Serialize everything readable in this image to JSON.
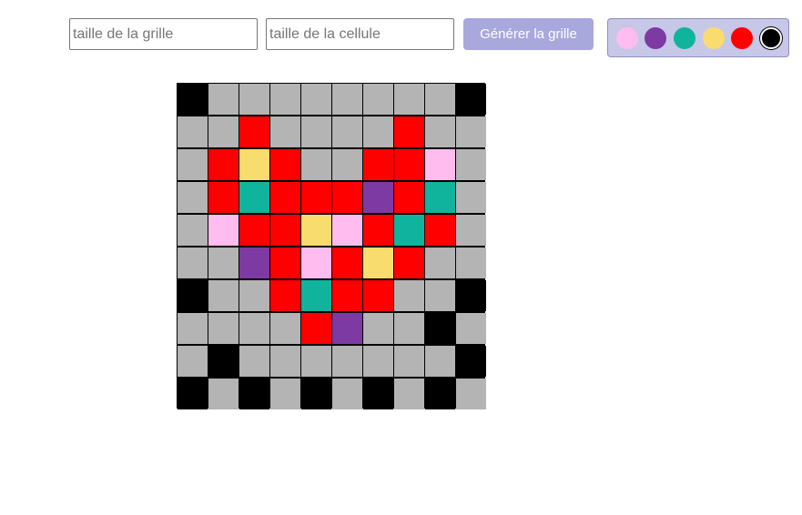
{
  "toolbar": {
    "grid_size_placeholder": "taille de la grille",
    "cell_size_placeholder": "taille de la cellule",
    "generate_label": "Générer la grille",
    "generate_color": "#a8a8dc",
    "palette_background": "#c7c7e8"
  },
  "palette": {
    "selected_index": 5,
    "colors": [
      "#ffbcee",
      "#7e3aa3",
      "#10b49c",
      "#f9dc6e",
      "#ff0000",
      "#000000"
    ]
  },
  "grid": {
    "rows": 10,
    "cols": 10,
    "legend": {
      "B": "#000000",
      "G": "#b4b4b4",
      "R": "#ff0000",
      "Y": "#f9dc6e",
      "P": "#ffbcee",
      "T": "#10b49c",
      "V": "#7e3aa3"
    },
    "cells": [
      "BGGGGGGGGB",
      "GGRGGGGRGG",
      "GRYRGGRRPG",
      "GRTRRRVRTG",
      "GPRRYPRTRG",
      "GGVRPRYRGG",
      "BGGRTRRGGB",
      "GGGGRVGGBG",
      "GBGGGGGGGB",
      "BGBGBGBGBG"
    ]
  }
}
